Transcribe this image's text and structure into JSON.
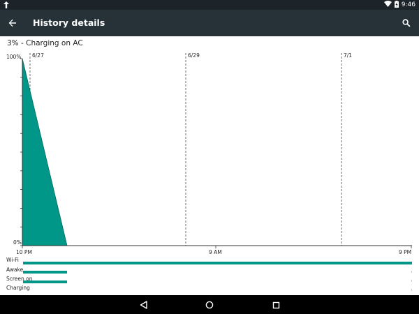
{
  "statusbar": {
    "time": "9:46"
  },
  "appbar": {
    "title": "History details"
  },
  "battery": {
    "status_text": "3% - Charging on AC"
  },
  "chart_data": {
    "type": "area",
    "y_tick_labels": [
      "100%",
      "0%"
    ],
    "date_markers": [
      "6/27",
      "6/29",
      "7/1"
    ],
    "time_labels": [
      "10 PM",
      "9 AM",
      "9 PM"
    ],
    "series": [
      {
        "values": [
          100,
          0
        ]
      }
    ],
    "ylim": [
      0,
      100
    ],
    "grid": false,
    "rows": [
      {
        "label": "Wi-Fi"
      },
      {
        "label": "Awake"
      },
      {
        "label": "Screen on"
      },
      {
        "label": "Charging"
      }
    ]
  },
  "colors": {
    "accent": "#009688",
    "appbar": "#263238",
    "statusbar": "#1c2429",
    "navbar": "#000000"
  }
}
